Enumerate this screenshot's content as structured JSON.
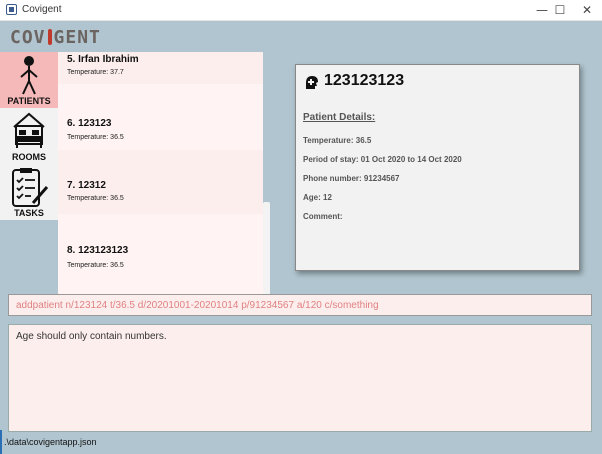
{
  "window": {
    "title": "Covigent",
    "minimize": "—",
    "maximize": "☐",
    "close": "✕"
  },
  "logo": {
    "left": "COV",
    "right": "GENT"
  },
  "nav": {
    "patients": "PATIENTS",
    "rooms": "ROOMS",
    "tasks": "TASKS"
  },
  "patients": [
    {
      "name": "5.  Irfan Ibrahim",
      "temperature": "Temperature: 37.7"
    },
    {
      "name": "6.  123123",
      "temperature": "Temperature: 36.5"
    },
    {
      "name": "7.  12312",
      "temperature": "Temperature: 36.5"
    },
    {
      "name": "8.  123123123",
      "temperature": "Temperature: 36.5"
    }
  ],
  "detail": {
    "title": "123123123",
    "heading": "Patient Details:",
    "temperature": "Temperature: 36.5",
    "period": "Period of stay: 01 Oct 2020 to 14 Oct 2020",
    "phone": "Phone number: 91234567",
    "age": "Age: 12",
    "comment": "Comment:"
  },
  "command": {
    "text": "addpatient n/123124 t/36.5 d/20201001-20201014 p/91234567 a/120 c/something"
  },
  "result": {
    "text": "Age should only contain numbers."
  },
  "status": {
    "path": ".\\data\\covigentapp.json"
  },
  "icons": {
    "app": "app-window-icon",
    "patients": "stick-figure-icon",
    "rooms": "bedroom-icon",
    "tasks": "clipboard-checklist-icon",
    "detail": "patient-head-icon"
  },
  "colors": {
    "background": "#b0c5cf",
    "selected_tab": "#f6b9b9",
    "panel": "#fdeeee",
    "command_text": "#e08080"
  }
}
